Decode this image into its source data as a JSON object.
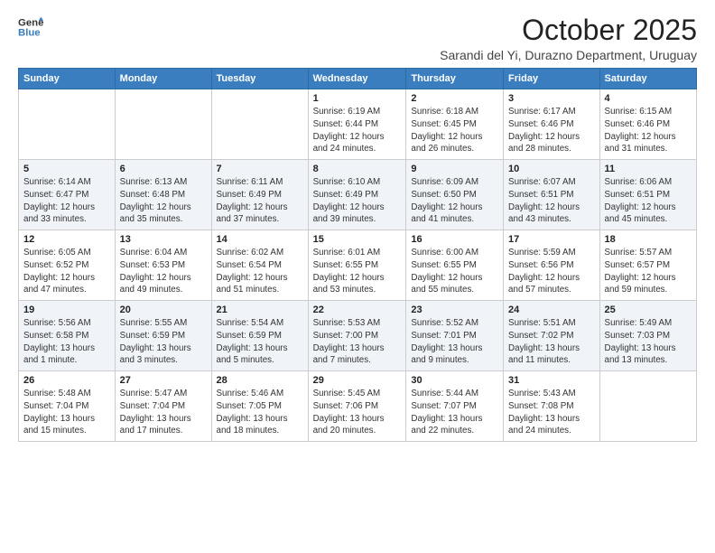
{
  "logo": {
    "line1": "General",
    "line2": "Blue"
  },
  "title": "October 2025",
  "location": "Sarandi del Yi, Durazno Department, Uruguay",
  "weekdays": [
    "Sunday",
    "Monday",
    "Tuesday",
    "Wednesday",
    "Thursday",
    "Friday",
    "Saturday"
  ],
  "weeks": [
    [
      {
        "day": "",
        "info": ""
      },
      {
        "day": "",
        "info": ""
      },
      {
        "day": "",
        "info": ""
      },
      {
        "day": "1",
        "info": "Sunrise: 6:19 AM\nSunset: 6:44 PM\nDaylight: 12 hours\nand 24 minutes."
      },
      {
        "day": "2",
        "info": "Sunrise: 6:18 AM\nSunset: 6:45 PM\nDaylight: 12 hours\nand 26 minutes."
      },
      {
        "day": "3",
        "info": "Sunrise: 6:17 AM\nSunset: 6:46 PM\nDaylight: 12 hours\nand 28 minutes."
      },
      {
        "day": "4",
        "info": "Sunrise: 6:15 AM\nSunset: 6:46 PM\nDaylight: 12 hours\nand 31 minutes."
      }
    ],
    [
      {
        "day": "5",
        "info": "Sunrise: 6:14 AM\nSunset: 6:47 PM\nDaylight: 12 hours\nand 33 minutes."
      },
      {
        "day": "6",
        "info": "Sunrise: 6:13 AM\nSunset: 6:48 PM\nDaylight: 12 hours\nand 35 minutes."
      },
      {
        "day": "7",
        "info": "Sunrise: 6:11 AM\nSunset: 6:49 PM\nDaylight: 12 hours\nand 37 minutes."
      },
      {
        "day": "8",
        "info": "Sunrise: 6:10 AM\nSunset: 6:49 PM\nDaylight: 12 hours\nand 39 minutes."
      },
      {
        "day": "9",
        "info": "Sunrise: 6:09 AM\nSunset: 6:50 PM\nDaylight: 12 hours\nand 41 minutes."
      },
      {
        "day": "10",
        "info": "Sunrise: 6:07 AM\nSunset: 6:51 PM\nDaylight: 12 hours\nand 43 minutes."
      },
      {
        "day": "11",
        "info": "Sunrise: 6:06 AM\nSunset: 6:51 PM\nDaylight: 12 hours\nand 45 minutes."
      }
    ],
    [
      {
        "day": "12",
        "info": "Sunrise: 6:05 AM\nSunset: 6:52 PM\nDaylight: 12 hours\nand 47 minutes."
      },
      {
        "day": "13",
        "info": "Sunrise: 6:04 AM\nSunset: 6:53 PM\nDaylight: 12 hours\nand 49 minutes."
      },
      {
        "day": "14",
        "info": "Sunrise: 6:02 AM\nSunset: 6:54 PM\nDaylight: 12 hours\nand 51 minutes."
      },
      {
        "day": "15",
        "info": "Sunrise: 6:01 AM\nSunset: 6:55 PM\nDaylight: 12 hours\nand 53 minutes."
      },
      {
        "day": "16",
        "info": "Sunrise: 6:00 AM\nSunset: 6:55 PM\nDaylight: 12 hours\nand 55 minutes."
      },
      {
        "day": "17",
        "info": "Sunrise: 5:59 AM\nSunset: 6:56 PM\nDaylight: 12 hours\nand 57 minutes."
      },
      {
        "day": "18",
        "info": "Sunrise: 5:57 AM\nSunset: 6:57 PM\nDaylight: 12 hours\nand 59 minutes."
      }
    ],
    [
      {
        "day": "19",
        "info": "Sunrise: 5:56 AM\nSunset: 6:58 PM\nDaylight: 13 hours\nand 1 minute."
      },
      {
        "day": "20",
        "info": "Sunrise: 5:55 AM\nSunset: 6:59 PM\nDaylight: 13 hours\nand 3 minutes."
      },
      {
        "day": "21",
        "info": "Sunrise: 5:54 AM\nSunset: 6:59 PM\nDaylight: 13 hours\nand 5 minutes."
      },
      {
        "day": "22",
        "info": "Sunrise: 5:53 AM\nSunset: 7:00 PM\nDaylight: 13 hours\nand 7 minutes."
      },
      {
        "day": "23",
        "info": "Sunrise: 5:52 AM\nSunset: 7:01 PM\nDaylight: 13 hours\nand 9 minutes."
      },
      {
        "day": "24",
        "info": "Sunrise: 5:51 AM\nSunset: 7:02 PM\nDaylight: 13 hours\nand 11 minutes."
      },
      {
        "day": "25",
        "info": "Sunrise: 5:49 AM\nSunset: 7:03 PM\nDaylight: 13 hours\nand 13 minutes."
      }
    ],
    [
      {
        "day": "26",
        "info": "Sunrise: 5:48 AM\nSunset: 7:04 PM\nDaylight: 13 hours\nand 15 minutes."
      },
      {
        "day": "27",
        "info": "Sunrise: 5:47 AM\nSunset: 7:04 PM\nDaylight: 13 hours\nand 17 minutes."
      },
      {
        "day": "28",
        "info": "Sunrise: 5:46 AM\nSunset: 7:05 PM\nDaylight: 13 hours\nand 18 minutes."
      },
      {
        "day": "29",
        "info": "Sunrise: 5:45 AM\nSunset: 7:06 PM\nDaylight: 13 hours\nand 20 minutes."
      },
      {
        "day": "30",
        "info": "Sunrise: 5:44 AM\nSunset: 7:07 PM\nDaylight: 13 hours\nand 22 minutes."
      },
      {
        "day": "31",
        "info": "Sunrise: 5:43 AM\nSunset: 7:08 PM\nDaylight: 13 hours\nand 24 minutes."
      },
      {
        "day": "",
        "info": ""
      }
    ]
  ]
}
